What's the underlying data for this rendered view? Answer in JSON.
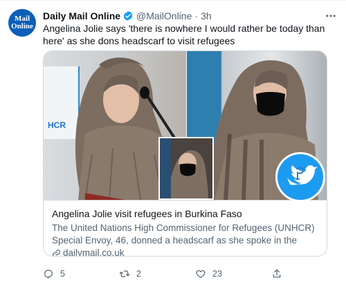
{
  "tweet": {
    "avatar_line1": "Mail",
    "avatar_line2": "Online",
    "display_name": "Daily Mail Online",
    "handle": "@MailOnline",
    "separator": "·",
    "timestamp": "3h",
    "more_icon": "more-horizontal-icon",
    "text": "Angelina Jolie says 'there is nowhere I would rather be today than here' as she dons headscarf to visit refugees",
    "brand_color": "#1d9bf0"
  },
  "media": {
    "banner_text": "HCR"
  },
  "card": {
    "title": "Angelina Jolie visit refugees in Burkina Faso",
    "description": "The United Nations High Commissioner for Refugees (UNHCR) Special Envoy, 46, donned a headscarf as she spoke in the West African nation ...",
    "domain": "dailymail.co.uk"
  },
  "actions": {
    "reply_count": "5",
    "retweet_count": "2",
    "like_count": "23"
  }
}
